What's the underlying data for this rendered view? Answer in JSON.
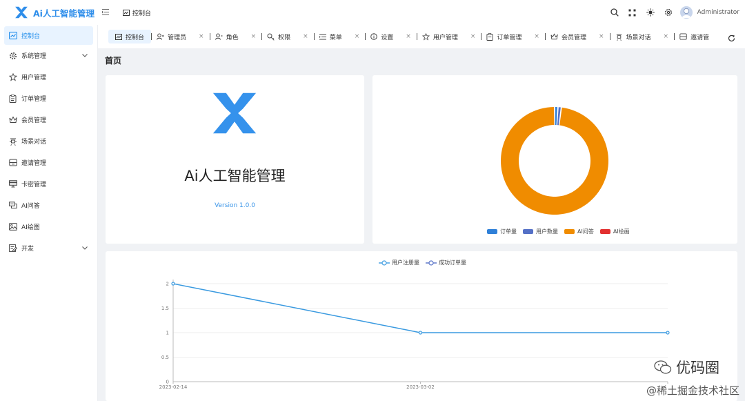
{
  "header": {
    "logo_text": "Ai人工智能管理",
    "menu_toggle_icon": "menu-fold-icon",
    "breadcrumb": "控制台",
    "username": "Administrator",
    "actions": [
      "search-icon",
      "fullscreen-icon",
      "theme-sun-icon",
      "settings-gear-icon"
    ]
  },
  "sidebar": {
    "items": [
      {
        "label": "控制台",
        "icon": "dashboard-icon",
        "active": true,
        "expandable": false
      },
      {
        "label": "系统管理",
        "icon": "gear-icon",
        "active": false,
        "expandable": true
      },
      {
        "label": "用户管理",
        "icon": "user-icon",
        "active": false,
        "expandable": false
      },
      {
        "label": "订单管理",
        "icon": "clipboard-icon",
        "active": false,
        "expandable": false
      },
      {
        "label": "会员管理",
        "icon": "crown-icon",
        "active": false,
        "expandable": false
      },
      {
        "label": "场景对话",
        "icon": "scene-icon",
        "active": false,
        "expandable": false
      },
      {
        "label": "邀请管理",
        "icon": "invite-icon",
        "active": false,
        "expandable": false
      },
      {
        "label": "卡密管理",
        "icon": "card-icon",
        "active": false,
        "expandable": false
      },
      {
        "label": "AI问答",
        "icon": "chat-icon",
        "active": false,
        "expandable": false
      },
      {
        "label": "AI绘图",
        "icon": "image-icon",
        "active": false,
        "expandable": false
      },
      {
        "label": "开发",
        "icon": "dev-icon",
        "active": false,
        "expandable": true
      }
    ]
  },
  "tabs": {
    "items": [
      {
        "label": "控制台",
        "icon": "dashboard-icon",
        "active": true,
        "closable": false
      },
      {
        "label": "管理员",
        "icon": "admin-user-icon",
        "active": false,
        "closable": true
      },
      {
        "label": "角色",
        "icon": "role-icon",
        "active": false,
        "closable": true
      },
      {
        "label": "权限",
        "icon": "key-icon",
        "active": false,
        "closable": true
      },
      {
        "label": "菜单",
        "icon": "menu-list-icon",
        "active": false,
        "closable": true
      },
      {
        "label": "设置",
        "icon": "info-circle-icon",
        "active": false,
        "closable": true
      },
      {
        "label": "用户管理",
        "icon": "user-icon",
        "active": false,
        "closable": true
      },
      {
        "label": "订单管理",
        "icon": "clipboard-icon",
        "active": false,
        "closable": true
      },
      {
        "label": "会员管理",
        "icon": "crown-icon",
        "active": false,
        "closable": true
      },
      {
        "label": "场景对话",
        "icon": "scene-icon",
        "active": false,
        "closable": true
      },
      {
        "label": "邀请管",
        "icon": "invite-icon",
        "active": false,
        "closable": false
      }
    ],
    "close_glyph": "×",
    "refresh_icon": "refresh-icon"
  },
  "main": {
    "page_title": "首页",
    "brand": {
      "name": "Ai人工智能管理",
      "version": "Version 1.0.0"
    }
  },
  "colors": {
    "accent": "#1f8ceb",
    "active_bg": "#e8f3ff",
    "logo_blue": "#2f8eea"
  },
  "chart_data": [
    {
      "type": "pie",
      "variant": "donut",
      "categories": [
        "订单量",
        "用户数量",
        "AI问答",
        "AI绘画"
      ],
      "values": [
        1,
        1,
        98,
        0
      ],
      "colors": [
        "#2f80d8",
        "#5470c6",
        "#f08c00",
        "#e23030"
      ],
      "legend_position": "bottom-center"
    },
    {
      "type": "line",
      "x": [
        "2023-02-14",
        "2023-03-02",
        ""
      ],
      "series": [
        {
          "name": "用户注册量",
          "values": [
            2,
            1,
            1
          ],
          "color": "#3a9ae0"
        },
        {
          "name": "成功订单量",
          "values": [],
          "color": "#5470c6"
        }
      ],
      "y_ticks": [
        "0",
        "0.5",
        "1",
        "1.5",
        "2"
      ],
      "ylim": [
        0,
        2
      ],
      "grid": true,
      "legend_position": "top-center"
    }
  ],
  "watermark": {
    "main": "优码圈",
    "sub": "@稀土掘金技术社区"
  }
}
